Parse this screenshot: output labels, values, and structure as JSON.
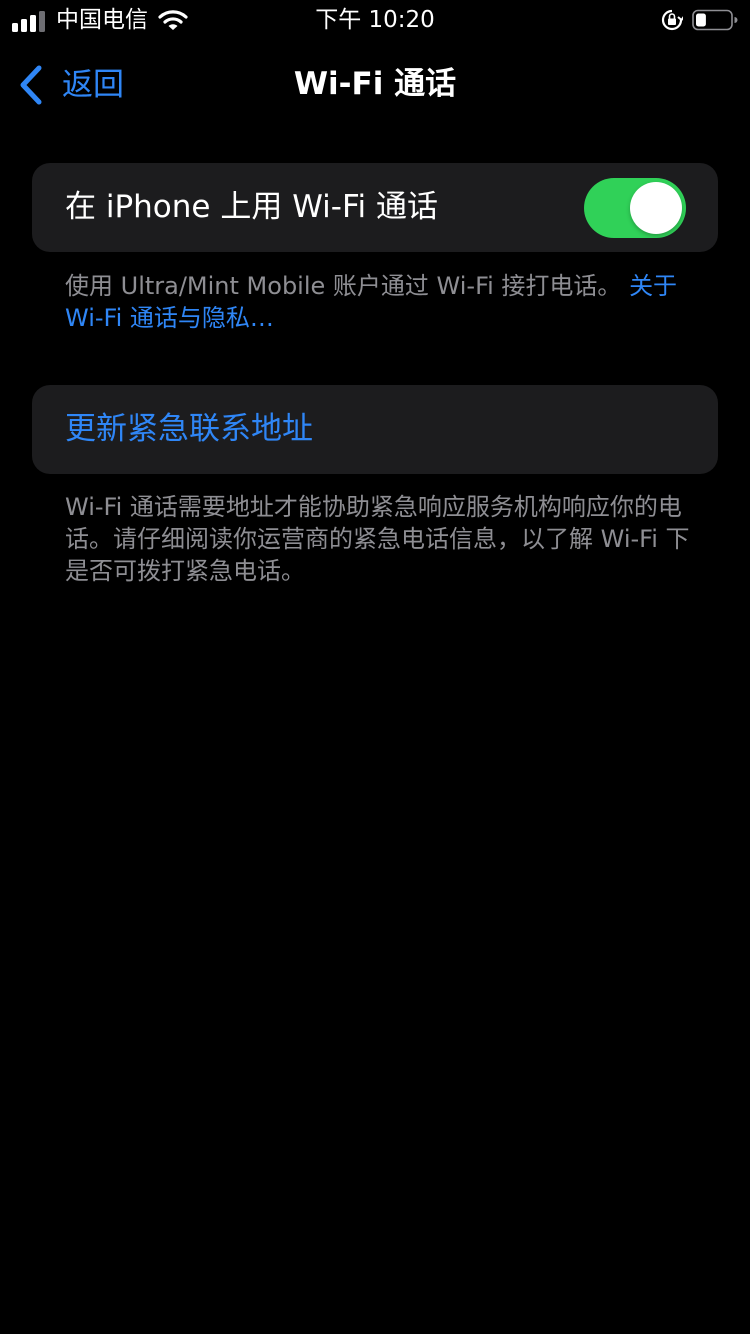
{
  "status_bar": {
    "carrier": "中国电信",
    "time": "下午 10:20",
    "battery_level": 0.3
  },
  "nav": {
    "back_label": "返回",
    "title": "Wi-Fi 通话"
  },
  "wifi_calling": {
    "toggle_label": "在 iPhone 上用 Wi-Fi 通话",
    "toggle_on": true,
    "footer_text": "使用 Ultra/Mint Mobile 账户通过 Wi-Fi 接打电话。 ",
    "footer_link": "关于 Wi-Fi 通话与隐私…"
  },
  "emergency": {
    "update_address_label": "更新紧急联系地址",
    "footer_text": "Wi-Fi 通话需要地址才能协助紧急响应服务机构响应你的电话。请仔细阅读你运营商的紧急电话信息，以了解 Wi-Fi 下是否可拨打紧急电话。"
  },
  "colors": {
    "accent": "#2f86f6",
    "toggle_on": "#30d158",
    "background": "#000000",
    "cell": "#1c1c1e",
    "secondary_text": "#8e8e93"
  },
  "icons": {
    "signal": "cellular-signal-icon",
    "wifi": "wifi-icon",
    "rotation_lock": "rotation-lock-icon",
    "battery": "battery-icon",
    "back": "chevron-left-icon"
  }
}
